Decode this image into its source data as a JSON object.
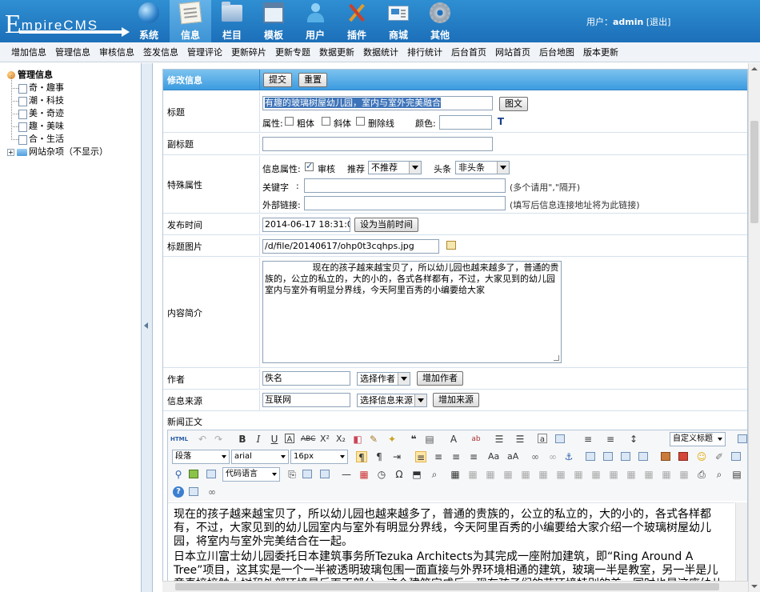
{
  "logo": {
    "first_letter": "E",
    "rest": "mpireCMS"
  },
  "nav": [
    {
      "label": "系统",
      "icon": "globe-icon",
      "active": false
    },
    {
      "label": "信息",
      "icon": "document-icon",
      "active": true
    },
    {
      "label": "栏目",
      "icon": "folder-icon",
      "active": false
    },
    {
      "label": "模板",
      "icon": "window-icon",
      "active": false
    },
    {
      "label": "用户",
      "icon": "user-icon",
      "active": false
    },
    {
      "label": "插件",
      "icon": "tools-icon",
      "active": false
    },
    {
      "label": "商城",
      "icon": "shop-icon",
      "active": false
    },
    {
      "label": "其他",
      "icon": "gear-icon",
      "active": false
    }
  ],
  "userbar": {
    "prefix": "用户：",
    "username": "admin",
    "logout": "[退出]"
  },
  "subnav": [
    "增加信息",
    "管理信息",
    "审核信息",
    "签发信息",
    "管理评论",
    "更新碎片",
    "更新专题",
    "数据更新",
    "数据统计",
    "排行统计",
    "后台首页",
    "网站首页",
    "后台地图",
    "版本更新"
  ],
  "tree": {
    "root": "管理信息",
    "children": [
      "奇・趣事",
      "潮・科技",
      "美・奇迹",
      "趣・美味",
      "合・生活"
    ],
    "folder": "网站杂项（不显示）"
  },
  "form": {
    "header": {
      "label": "修改信息",
      "submit": "提交",
      "reset": "重置"
    },
    "title": {
      "label": "标题",
      "value": "有趣的玻璃树屋幼儿园，室内与室外完美融合",
      "image_btn": "图文",
      "attr_label": "属性:",
      "bold": "粗体",
      "italic": "斜体",
      "strike": "删除线",
      "color_label": "颜色:"
    },
    "subtitle": {
      "label": "副标题",
      "value": ""
    },
    "special": {
      "label": "特殊属性",
      "info_attr": "信息属性:",
      "audit": "审核",
      "recommend_label": "推荐",
      "recommend_value": "不推荐",
      "headline_label": "头条",
      "headline_value": "非头条",
      "keyword_label": "关键字",
      "keyword_colon": ":",
      "keyword_hint": "(多个请用\",\"隔开)",
      "link_label": "外部链接:",
      "link_hint": "(填写后信息连接地址将为此链接)"
    },
    "pubtime": {
      "label": "发布时间",
      "value": "2014-06-17 18:31:04",
      "btn": "设为当前时间"
    },
    "titlepic": {
      "label": "标题图片",
      "value": "/d/file/20140617/ohp0t3cqhps.jpg"
    },
    "summary": {
      "label": "内容简介",
      "value": "                 现在的孩子越来越宝贝了，所以幼儿园也越来越多了，普通的贵族的，公立的私立的，大的小的，各式各样都有，不过，大家见到的幼儿园室内与室外有明显分界线，今天阿里百秀的小编要给大家"
    },
    "author": {
      "label": "作者",
      "value": "佚名",
      "select": "选择作者",
      "add_btn": "增加作者"
    },
    "source": {
      "label": "信息来源",
      "value": "互联网",
      "select": "选择信息来源",
      "add_btn": "增加来源"
    },
    "newstext": {
      "label": "新闻正文"
    }
  },
  "editor": {
    "html_btn": "HTML",
    "style_select": "自定义标题",
    "paragraph_select": "段落",
    "font_select": "arial",
    "size_select": "16px",
    "code_select": "代码语言",
    "body": [
      "现在的孩子越来越宝贝了，所以幼儿园也越来越多了，普通的贵族的，公立的私立的，大的小的，各式各样都有，不过，大家见到的幼儿园室内与室外有明显分界线，今天阿里百秀的小编要给大家介绍一个玻璃树屋幼儿园，将室内与室外完美结合在一起。",
      "日本立川富士幼儿园委托日本建筑事务所Tezuka Architects为其完成一座附加建筑，即“Ring Around A Tree”项目，这其实是一个一半被透明玻璃包围一面直接与外界环境相通的建筑，玻璃一半是教室，另一半是儿童直接接触大树和外部环境最后面不部分，这个建筑完成后，现在孩子们的花环境特别的美，同时也是这座幼儿园的一大亮点。"
    ]
  }
}
